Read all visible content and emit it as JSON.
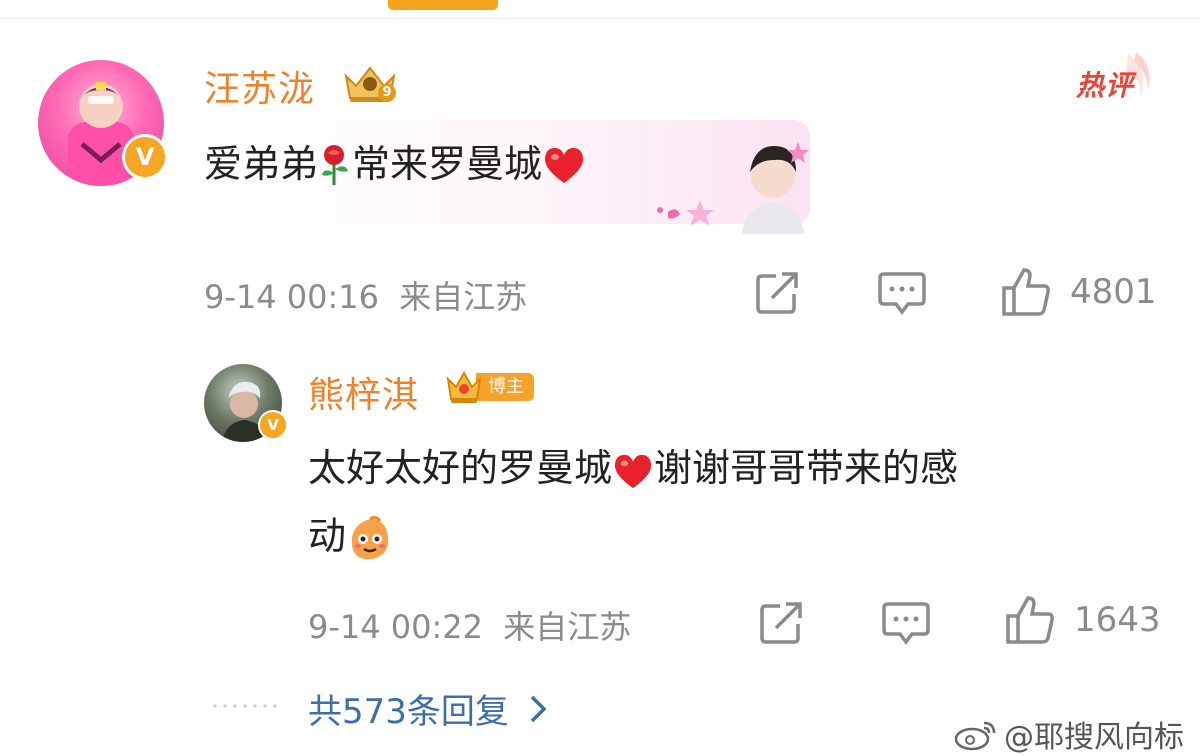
{
  "comment": {
    "username": "汪苏泷",
    "crown_level": "9",
    "hot_label": "热评",
    "text_before": "爱弟弟",
    "text_after": "常来罗曼城",
    "timestamp": "9-14 00:16",
    "location": "来自江苏",
    "likes": "4801"
  },
  "reply": {
    "username": "熊梓淇",
    "host_label": "博主",
    "text_line1": "太好太好的罗曼城",
    "text_line1_after": "谢谢哥哥带来的感",
    "text_line2": "动",
    "timestamp": "9-14 00:22",
    "location": "来自江苏",
    "likes": "1643"
  },
  "replies_link": "共573条回复",
  "watermark": "@耶搜风向标",
  "colors": {
    "username": "#f0812b",
    "link": "#3e6ea8",
    "meta": "#8b8b8b",
    "hot": "#e8443a",
    "tab_indicator": "#f7a21b"
  },
  "icons": [
    "rose-emoji",
    "red-heart-emoji",
    "cute-face-emoji",
    "repost-icon",
    "comment-icon",
    "thumbs-up-icon",
    "chevron-right-icon",
    "weibo-logo-icon",
    "crown-icon",
    "verified-v-icon"
  ]
}
